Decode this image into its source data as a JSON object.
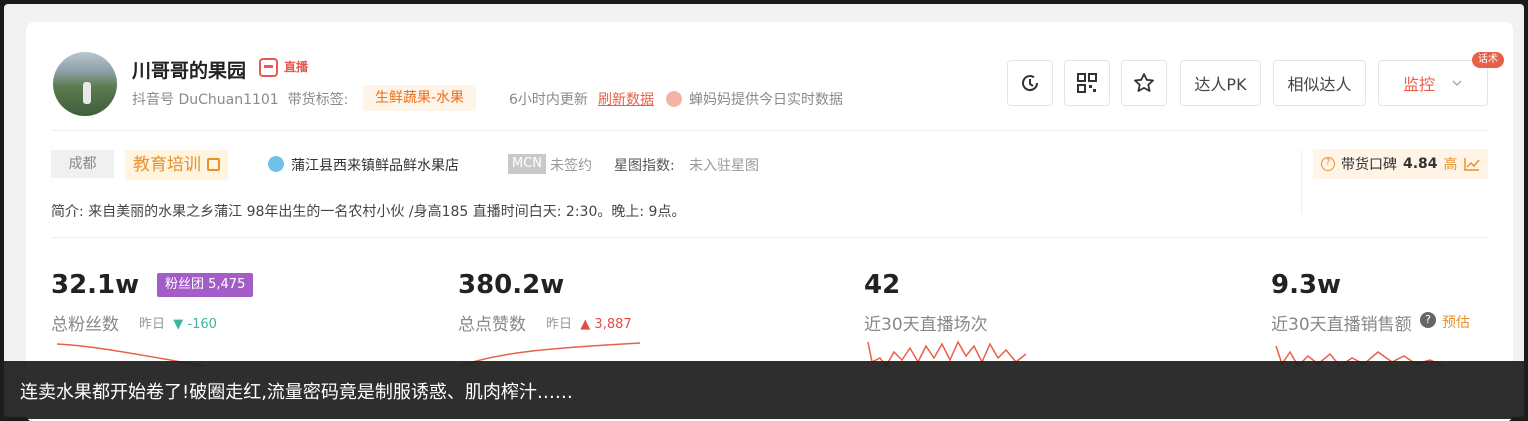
{
  "profile": {
    "name": "川哥哥的果园",
    "live_badge": "直播",
    "douyin_id": "抖音号 DuChuan1101",
    "tag_label": "带货标签:",
    "tag": "生鲜蔬果-水果",
    "update_text": "6小时内更新",
    "refresh": "刷新数据",
    "chanmama_text": "蝉妈妈提供今日实时数据"
  },
  "actions": {
    "pk": "达人PK",
    "similar": "相似达人",
    "monitor": "监控",
    "hua_badge": "话术"
  },
  "info": {
    "city": "成都",
    "category": "教育培训",
    "shop": "蒲江县西来镇鲜品鲜水果店",
    "mcn": "MCN",
    "mcn_status": "未签约",
    "star_label": "星图指数:",
    "star_value": "未入驻星图",
    "reputation_label": "带货口碑",
    "reputation_score": "4.84",
    "reputation_level": "高",
    "intro": "简介:  来自美丽的水果之乡蒲江 98年出生的一名农村小伙 /身高185 直播时间白天: 2:30。晚上: 9点。"
  },
  "stats": {
    "fans": {
      "value": "32.1w",
      "label": "总粉丝数",
      "fan_group": "粉丝团 5,475",
      "yday_label": "昨日",
      "yday_change": "-160"
    },
    "likes": {
      "value": "380.2w",
      "label": "总点赞数",
      "yday_label": "昨日",
      "yday_change": "3,887"
    },
    "live": {
      "value": "42",
      "label": "近30天直播场次"
    },
    "sales": {
      "value": "9.3w",
      "label": "近30天直播销售额",
      "estimate": "预估"
    }
  },
  "caption": "连卖水果都开始卷了!破圈走红,流量密码竟是制服诱惑、肌肉榨汁……",
  "colors": {
    "accent": "#e8604a",
    "fan_group": "#a35cc8",
    "orange": "#e8912a"
  }
}
